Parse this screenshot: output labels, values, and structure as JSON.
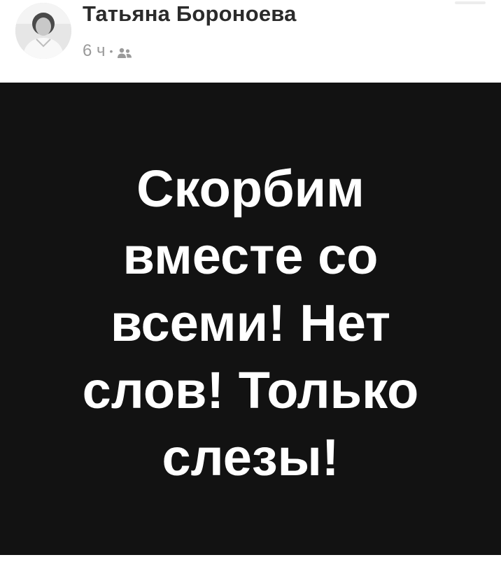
{
  "post": {
    "author": "Татьяна Бороноева",
    "time": "6 ч",
    "separator": "•",
    "audience_icon": "friends-icon",
    "image_text": "Скорбим\nвместе со\nвсеми! Нет\nслов! Только\nслезы!"
  },
  "colors": {
    "image_background": "#121212",
    "image_text": "#ffffff",
    "author_name": "#2b2b2b",
    "meta_text": "#9a9a9a"
  }
}
